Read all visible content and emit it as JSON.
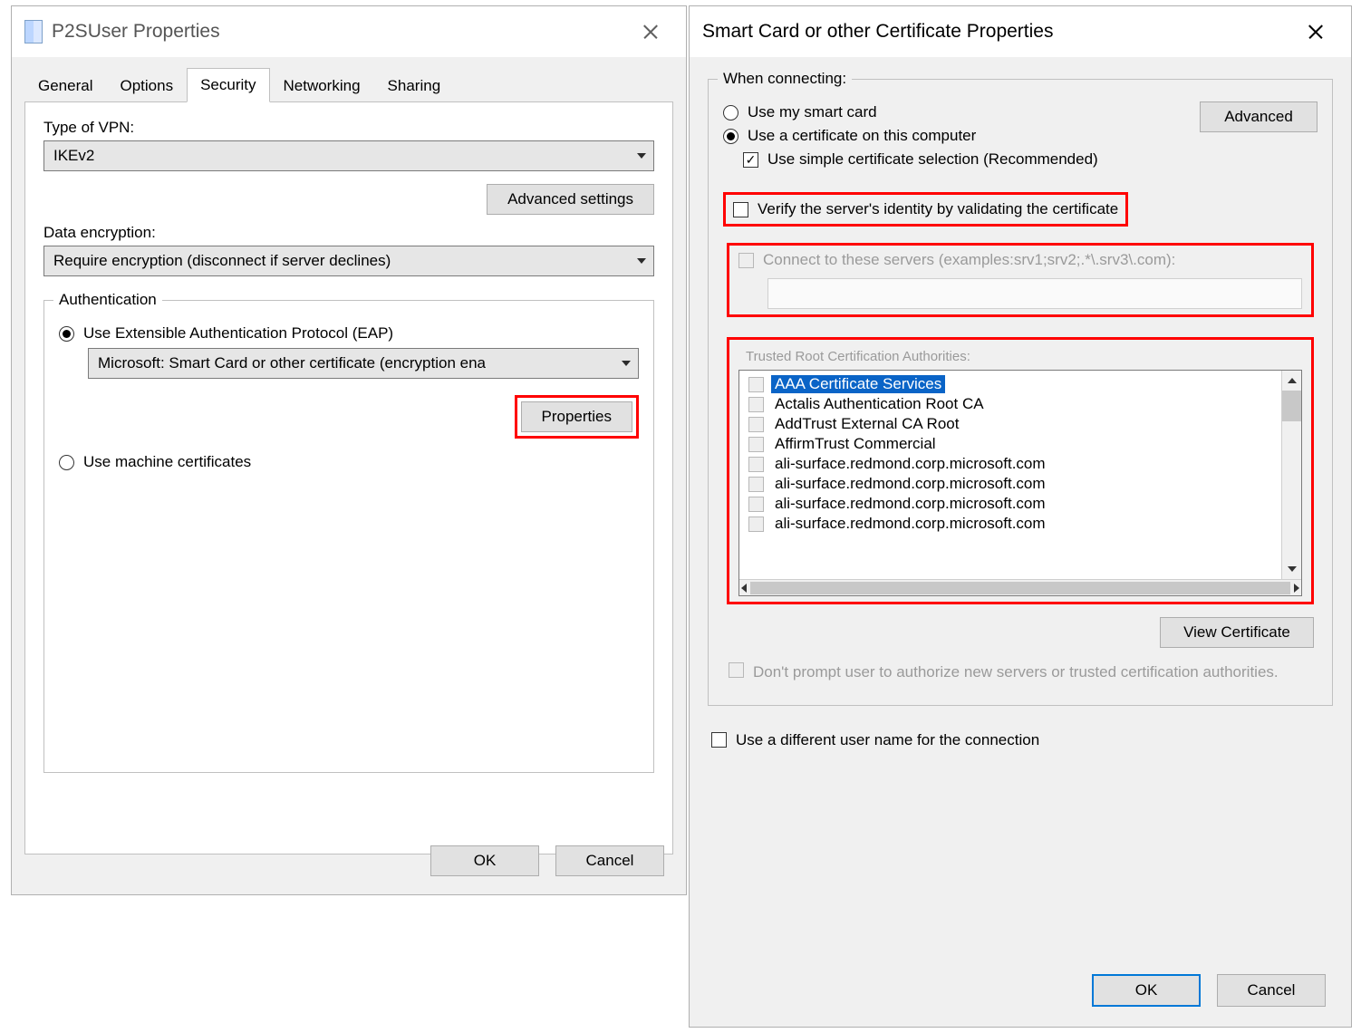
{
  "left": {
    "title": "P2SUser Properties",
    "tabs": [
      "General",
      "Options",
      "Security",
      "Networking",
      "Sharing"
    ],
    "active_tab_index": 2,
    "type_of_vpn_label": "Type of VPN:",
    "type_of_vpn_value": "IKEv2",
    "advanced_settings_btn": "Advanced settings",
    "data_encryption_label": "Data encryption:",
    "data_encryption_value": "Require encryption (disconnect if server declines)",
    "auth_group": "Authentication",
    "use_eap_label": "Use Extensible Authentication Protocol (EAP)",
    "eap_select_value": "Microsoft: Smart Card or other certificate (encryption ena",
    "properties_btn": "Properties",
    "use_machine_label": "Use machine certificates",
    "ok_btn": "OK",
    "cancel_btn": "Cancel"
  },
  "right": {
    "title": "Smart Card or other Certificate Properties",
    "when_connecting_group": "When connecting:",
    "use_smart_card": "Use my smart card",
    "use_cert": "Use a certificate on this computer",
    "simple_sel": "Use simple certificate selection (Recommended)",
    "advanced_btn": "Advanced",
    "verify_server": "Verify the server's identity by validating the certificate",
    "connect_servers_label": "Connect to these servers (examples:srv1;srv2;.*\\.srv3\\.com):",
    "trusted_root_label": "Trusted Root Certification Authorities:",
    "ca_list": [
      "AAA Certificate Services",
      "Actalis Authentication Root CA",
      "AddTrust External CA Root",
      "AffirmTrust Commercial",
      "ali-surface.redmond.corp.microsoft.com",
      "ali-surface.redmond.corp.microsoft.com",
      "ali-surface.redmond.corp.microsoft.com",
      "ali-surface.redmond.corp.microsoft.com"
    ],
    "selected_ca_index": 0,
    "view_cert_btn": "View Certificate",
    "dont_prompt": "Don't prompt user to authorize new servers or trusted certification authorities.",
    "use_diff_user": "Use a different user name for the connection",
    "ok_btn": "OK",
    "cancel_btn": "Cancel"
  }
}
